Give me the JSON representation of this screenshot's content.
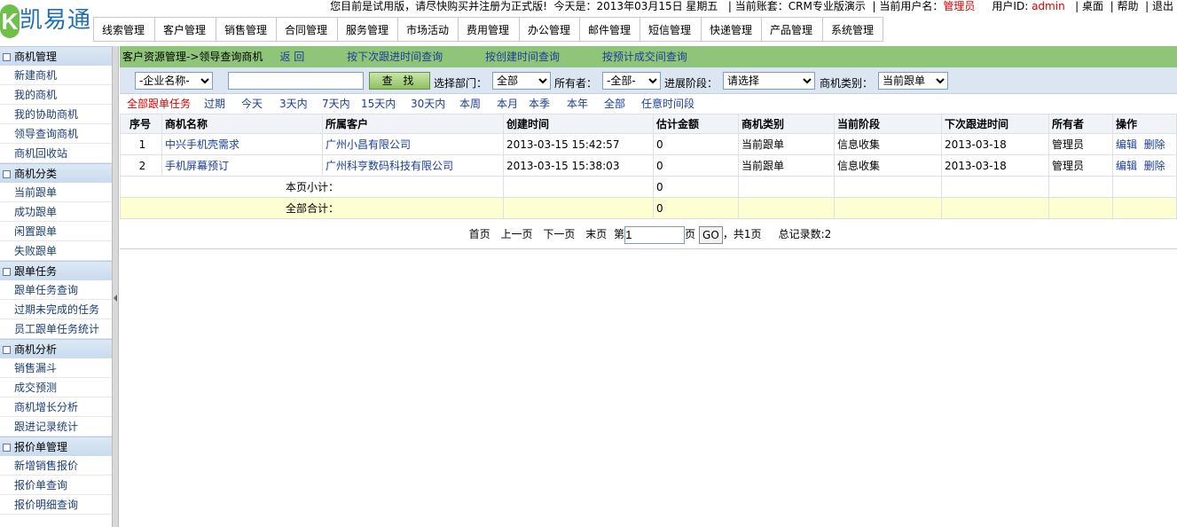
{
  "brand": {
    "k": "K",
    "name": "凯易通"
  },
  "topinfo": {
    "notice": "您目前是试用版，请尽快购买并注册为正式版!",
    "today_label": "今天是：",
    "today_value": "2013年03月15日  星期五",
    "account_label": "| 当前账套：",
    "account_value": "CRM专业版演示",
    "user_label": "| 当前用户名：",
    "user_value": "管理员",
    "userid_label": "用户ID:",
    "userid_value": "admin",
    "desktop": "| 桌面",
    "help": "| 帮助",
    "logout": "| 退出"
  },
  "menu": [
    "线索管理",
    "客户管理",
    "销售管理",
    "合同管理",
    "服务管理",
    "市场活动",
    "费用管理",
    "办公管理",
    "邮件管理",
    "短信管理",
    "快递管理",
    "产品管理",
    "系统管理"
  ],
  "sidebar": [
    {
      "title": "商机管理",
      "items": [
        "新建商机",
        "我的商机",
        "我的协助商机",
        "领导查询商机",
        "商机回收站"
      ]
    },
    {
      "title": "商机分类",
      "items": [
        "当前跟单",
        "成功跟单",
        "闲置跟单",
        "失败跟单"
      ]
    },
    {
      "title": "跟单任务",
      "items": [
        "跟单任务查询",
        "过期未完成的任务",
        "员工跟单任务统计"
      ]
    },
    {
      "title": "商机分析",
      "items": [
        "销售漏斗",
        "成交预测",
        "商机增长分析",
        "跟进记录统计"
      ]
    },
    {
      "title": "报价单管理",
      "items": [
        "新增销售报价",
        "报价单查询",
        "报价明细查询"
      ]
    }
  ],
  "crumb": {
    "path": "客户资源管理->领导查询商机",
    "back": "返 回",
    "by_next": "按下次跟进时间查询",
    "by_create": "按创建时间查询",
    "by_deal": "按预计成交间查询"
  },
  "filter": {
    "company_select": "-企业名称-",
    "search_value": "",
    "search_btn": "查 找",
    "dept_label": "选择部门：",
    "dept_value": "全部",
    "owner_label": "所有者：",
    "owner_value": "-全部-",
    "stage_label": "进展阶段：",
    "stage_value": "请选择",
    "type_label": "商机类别：",
    "type_value": "当前跟单"
  },
  "timeflt": [
    "全部跟单任务",
    "过期",
    "今天",
    "3天内",
    "7天内",
    "15天内",
    "30天内",
    "本周",
    "本月",
    "本季",
    "本年",
    "全部",
    "任意时间段"
  ],
  "table": {
    "headers": [
      "序号",
      "商机名称",
      "所属客户",
      "创建时间",
      "估计金额",
      "商机类别",
      "当前阶段",
      "下次跟进时间",
      "所有者",
      "操作"
    ],
    "rows": [
      {
        "no": "1",
        "name": "中兴手机壳需求",
        "customer": "广州小昌有限公司",
        "created": "2013-03-15 15:42:57",
        "amount": "0",
        "type": "当前跟单",
        "stage": "信息收集",
        "next": "2013-03-18",
        "owner": "管理员",
        "edit": "编辑",
        "del": "删除"
      },
      {
        "no": "2",
        "name": "手机屏幕预订",
        "customer": "广州科亨数码科技有限公司",
        "created": "2013-03-15 15:38:03",
        "amount": "0",
        "type": "当前跟单",
        "stage": "信息收集",
        "next": "2013-03-18",
        "owner": "管理员",
        "edit": "编辑",
        "del": "删除"
      }
    ],
    "subtotal_label": "本页小计：",
    "subtotal_value": "0",
    "total_label": "全部合计：",
    "total_value": "0"
  },
  "pager": {
    "first": "首页",
    "prev": "上一页",
    "next": "下一页",
    "last": "末页",
    "page_prefix": "第",
    "page_value": "1",
    "page_suffix": "页",
    "go": "GO",
    "total_pages": "，共1页",
    "record_count": "总记录数:2"
  }
}
